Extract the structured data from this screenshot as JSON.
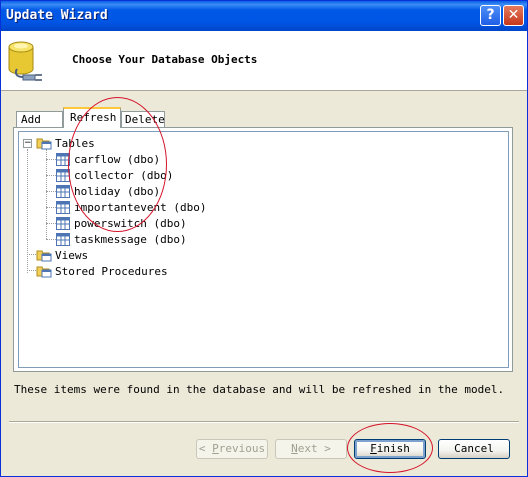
{
  "window": {
    "title": "Update Wizard",
    "help_icon": "?",
    "close_icon": "✕"
  },
  "header": {
    "title": "Choose Your Database Objects"
  },
  "tabs": [
    {
      "label": "Add",
      "selected": false
    },
    {
      "label": "Refresh",
      "selected": true
    },
    {
      "label": "Delete",
      "selected": false
    }
  ],
  "tree": {
    "tables": {
      "label": "Tables",
      "expander": "−",
      "items": [
        "carflow (dbo)",
        "collector (dbo)",
        "holiday (dbo)",
        "importantevent (dbo)",
        "powerswitch (dbo)",
        "taskmessage (dbo)"
      ]
    },
    "views": {
      "label": "Views"
    },
    "stored_procedures": {
      "label": "Stored Procedures"
    }
  },
  "status_text": "These items were found in the database and will be refreshed in the model.",
  "buttons": {
    "previous": {
      "prefix": "< ",
      "accel": "P",
      "rest": "revious",
      "enabled": false
    },
    "next": {
      "accel": "N",
      "rest": "ext >",
      "enabled": false
    },
    "finish": {
      "accel": "F",
      "rest": "inish",
      "enabled": true
    },
    "cancel": {
      "label": "Cancel",
      "enabled": true
    }
  },
  "colors": {
    "titlebar": "#0055e5",
    "annotation": "#d5132a",
    "window_bg": "#ece9d8"
  }
}
